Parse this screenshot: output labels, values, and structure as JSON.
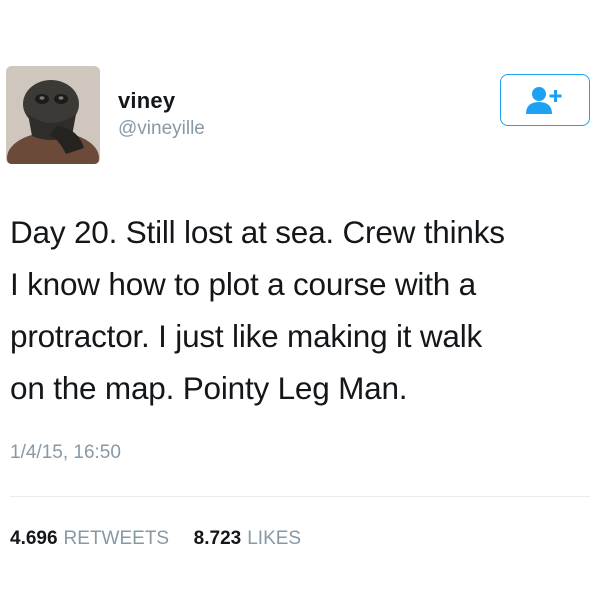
{
  "user": {
    "display_name": "viney",
    "handle": "@vineyille",
    "avatar_icon": "profile-photo"
  },
  "follow_button": {
    "icon": "add-user-icon",
    "color": "#1da1f2"
  },
  "tweet": {
    "lines": [
      "Day 20. Still lost at sea. Crew thinks",
      "I know how to plot a course with a",
      "protractor. I just like making it walk",
      "on the map. Pointy Leg Man."
    ],
    "timestamp": "1/4/15, 16:50"
  },
  "stats": {
    "retweets_count": "4.696",
    "retweets_label": "RETWEETS",
    "likes_count": "8.723",
    "likes_label": "LIKES"
  }
}
